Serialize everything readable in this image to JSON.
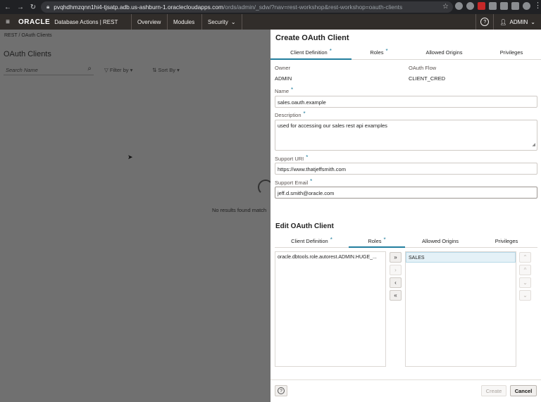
{
  "browser": {
    "url_main": "pvqhdhmzqnn1hi4-tjsatp.adb.us-ashburn-1.oraclecloudapps.com",
    "url_rest": "/ords/admin/_sdw/?nav=rest-workshop&rest-workshop=oauth-clients"
  },
  "header": {
    "logo": "ORACLE",
    "app_name": "Database Actions  |  REST",
    "tabs": [
      "Overview",
      "Modules",
      "Security"
    ],
    "user": "ADMIN"
  },
  "background": {
    "breadcrumb": "REST  /  OAuth Clients",
    "title": "OAuth Clients",
    "search_placeholder": "Search Name",
    "filter_label": "Filter by",
    "sort_label": "Sort By",
    "no_results": "No results found match"
  },
  "drawer": {
    "title": "Create OAuth Client",
    "tabs": [
      "Client Definition",
      "Roles",
      "Allowed Origins",
      "Privileges"
    ],
    "owner_label": "Owner",
    "owner_value": "ADMIN",
    "flow_label": "OAuth Flow",
    "flow_value": "CLIENT_CRED",
    "name_label": "Name",
    "name_value": "sales.oauth.example",
    "description_label": "Description",
    "description_value": "used for accessing our sales rest api examples",
    "support_uri_label": "Support URI",
    "support_uri_value": "https://www.thatjeffsmith.com",
    "support_email_label": "Support Email",
    "support_email_value": "jeff.d.smith@oracle.com",
    "edit_title": "Edit OAuth Client",
    "edit_tabs": [
      "Client Definition",
      "Roles",
      "Allowed Origins",
      "Privileges"
    ],
    "available_roles": [
      "oracle.dbtools.role.autorest.ADMIN.HUGE_..."
    ],
    "selected_roles": [
      "SALES"
    ],
    "create_label": "Create",
    "cancel_label": "Cancel",
    "required_mark": "*"
  }
}
